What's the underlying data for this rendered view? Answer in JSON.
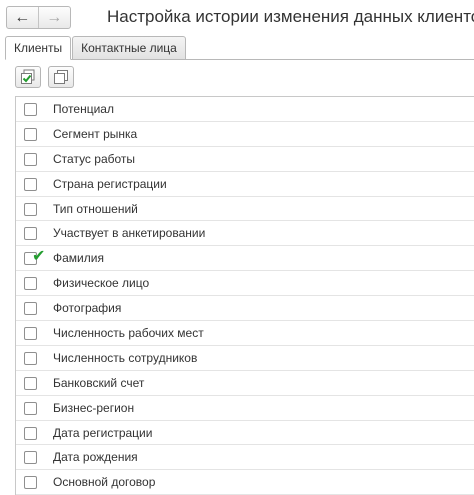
{
  "nav": {
    "back_icon": "arrow-left-icon",
    "forward_icon": "arrow-right-icon"
  },
  "title": "Настройка истории изменения данных клиентов",
  "tabs": [
    {
      "label": "Клиенты",
      "active": true
    },
    {
      "label": "Контактные лица",
      "active": false
    }
  ],
  "toolbar": {
    "buttons": [
      {
        "icon": "check-all-icon"
      },
      {
        "icon": "uncheck-all-icon"
      }
    ]
  },
  "fields": [
    {
      "label": "Потенциал",
      "checked": false
    },
    {
      "label": "Сегмент рынка",
      "checked": false
    },
    {
      "label": "Статус работы",
      "checked": false
    },
    {
      "label": "Страна регистрации",
      "checked": false
    },
    {
      "label": "Тип отношений",
      "checked": false
    },
    {
      "label": "Участвует в анкетировании",
      "checked": false
    },
    {
      "label": "Фамилия",
      "checked": true
    },
    {
      "label": "Физическое лицо",
      "checked": false
    },
    {
      "label": "Фотография",
      "checked": false
    },
    {
      "label": "Численность рабочих мест",
      "checked": false
    },
    {
      "label": "Численность сотрудников",
      "checked": false
    },
    {
      "label": "Банковский счет",
      "checked": false
    },
    {
      "label": "Бизнес-регион",
      "checked": false
    },
    {
      "label": "Дата регистрации",
      "checked": false
    },
    {
      "label": "Дата рождения",
      "checked": false
    },
    {
      "label": "Основной договор",
      "checked": false
    }
  ],
  "colors": {
    "check": "#239d2f",
    "border": "#b8b8b8"
  }
}
